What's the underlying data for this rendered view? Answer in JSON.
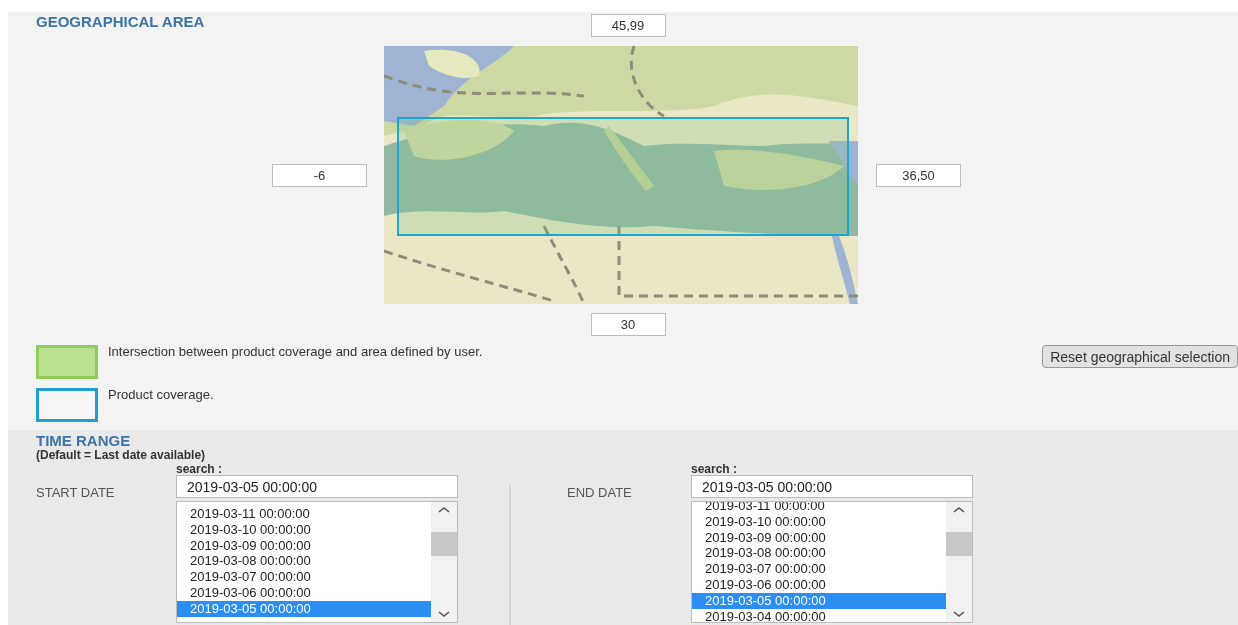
{
  "geographical_area": {
    "title": "GEOGRAPHICAL AREA",
    "north": "45,99",
    "west": "-6",
    "east": "36,50",
    "south": "30",
    "legend": [
      {
        "kind": "intersection",
        "text": "Intersection between product coverage and area defined by user."
      },
      {
        "kind": "coverage",
        "text": "Product coverage."
      }
    ],
    "reset_button": "Reset geographical selection"
  },
  "time_range": {
    "title": "TIME RANGE",
    "note": "(Default = Last date available)",
    "dates": [
      {
        "label": "START DATE",
        "search_label": "search :",
        "value": "2019-03-05 00:00:00",
        "options": [
          {
            "text": "2019-03-11 00:00:00",
            "selected": false
          },
          {
            "text": "2019-03-10 00:00:00",
            "selected": false
          },
          {
            "text": "2019-03-09 00:00:00",
            "selected": false
          },
          {
            "text": "2019-03-08 00:00:00",
            "selected": false
          },
          {
            "text": "2019-03-07 00:00:00",
            "selected": false
          },
          {
            "text": "2019-03-06 00:00:00",
            "selected": false
          },
          {
            "text": "2019-03-05 00:00:00",
            "selected": true
          }
        ]
      },
      {
        "label": "END DATE",
        "search_label": "search :",
        "value": "2019-03-05 00:00:00",
        "options": [
          {
            "text": "2019-03-11 00:00:00",
            "selected": false
          },
          {
            "text": "2019-03-10 00:00:00",
            "selected": false
          },
          {
            "text": "2019-03-09 00:00:00",
            "selected": false
          },
          {
            "text": "2019-03-08 00:00:00",
            "selected": false
          },
          {
            "text": "2019-03-07 00:00:00",
            "selected": false
          },
          {
            "text": "2019-03-06 00:00:00",
            "selected": false
          },
          {
            "text": "2019-03-05 00:00:00",
            "selected": true
          },
          {
            "text": "2019-03-04 00:00:00",
            "selected": false
          }
        ]
      }
    ]
  }
}
